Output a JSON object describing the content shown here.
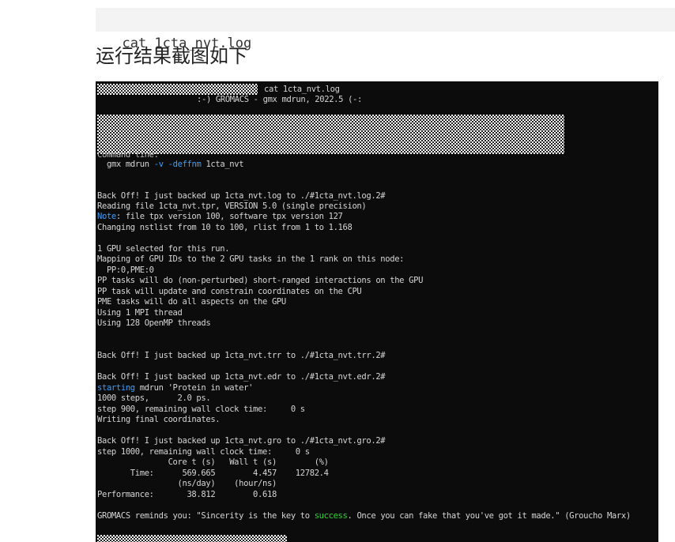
{
  "command_block": {
    "text": "cat 1cta_nvt.log"
  },
  "caption": "运行结果截图如下",
  "terminal": {
    "prompt_cmd": "cat 1cta_nvt.log",
    "banner": ":-) GROMACS - gmx mdrun, 2022.5 (-:",
    "command_line_label": "Command line:",
    "cmd_gmx": "gmx mdrun ",
    "cmd_flag_v": "-v",
    "cmd_flag_deffnm": "-deffnm",
    "cmd_arg": " 1cta_nvt",
    "line_backoff_log": "Back Off! I just backed up 1cta_nvt.log to ./#1cta_nvt.log.2#",
    "line_reading": "Reading file 1cta_nvt.tpr, VERSION 5.0 (single precision)",
    "note_word": "Note",
    "line_note_rest": ": file tpx version 100, software tpx version 127",
    "line_nstlist": "Changing nstlist from 10 to 100, rlist from 1 to 1.168",
    "line_gpu_selected": "1 GPU selected for this run.",
    "line_mapping": "Mapping of GPU IDs to the 2 GPU tasks in the 1 rank on this node:",
    "line_pp_pme": "  PP:0,PME:0",
    "line_pp_tasks": "PP tasks will do (non-perturbed) short-ranged interactions on the GPU",
    "line_pp_task": "PP task will update and constrain coordinates on the CPU",
    "line_pme_tasks": "PME tasks will do all aspects on the GPU",
    "line_mpi": "Using 1 MPI thread",
    "line_openmp": "Using 128 OpenMP threads",
    "line_backoff_trr": "Back Off! I just backed up 1cta_nvt.trr to ./#1cta_nvt.trr.2#",
    "line_backoff_edr": "Back Off! I just backed up 1cta_nvt.edr to ./#1cta_nvt.edr.2#",
    "starting_word": "starting",
    "line_starting_rest": " mdrun 'Protein in water'",
    "line_steps": "1000 steps,      2.0 ps.",
    "line_step900": "step 900, remaining wall clock time:     0 s",
    "line_writing": "Writing final coordinates.",
    "line_backoff_gro": "Back Off! I just backed up 1cta_nvt.gro to ./#1cta_nvt.gro.2#",
    "line_step1000": "step 1000, remaining wall clock time:     0 s",
    "line_hdr1": "               Core t (s)   Wall t (s)        (%)",
    "line_time": "       Time:      569.665        4.457    12782.4",
    "line_hdr2": "                 (ns/day)    (hour/ns)",
    "line_perf": "Performance:       38.812        0.618",
    "reminds_pre": "GROMACS reminds you: \"Sincerity is the key to ",
    "reminds_success": "success",
    "reminds_post": ". Once you can fake that you've got it made.\" (Groucho Marx)"
  }
}
